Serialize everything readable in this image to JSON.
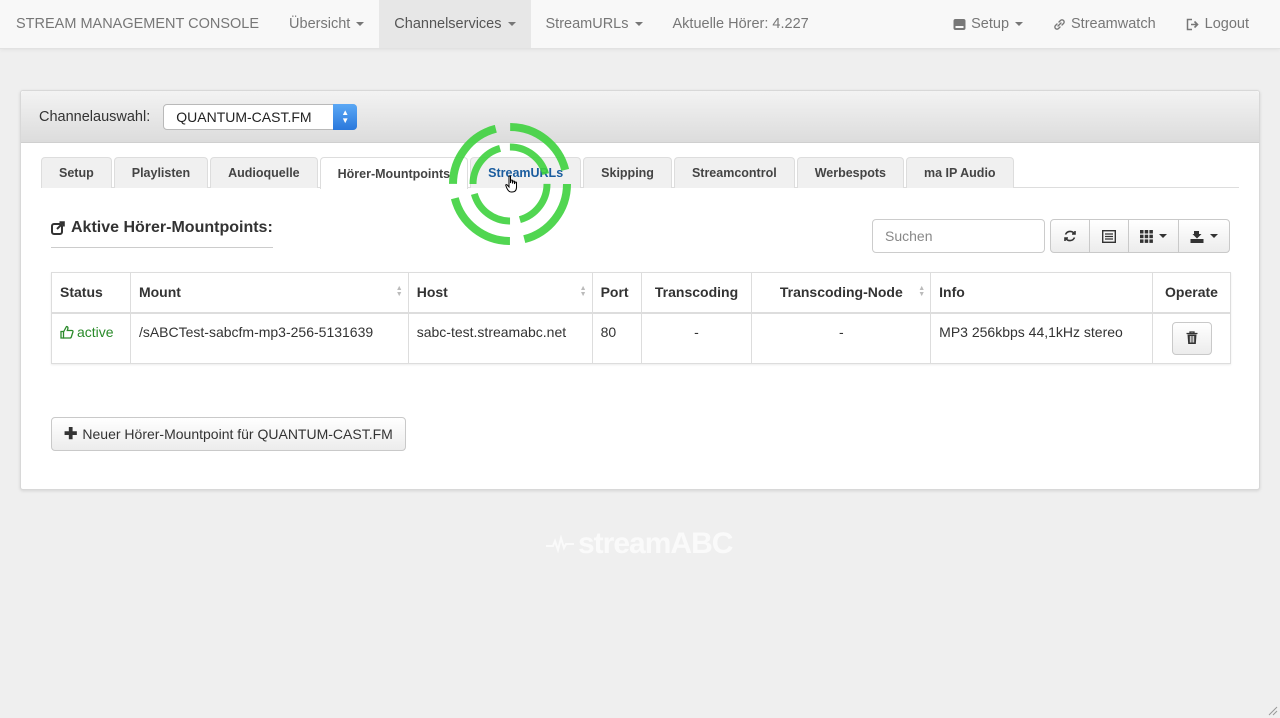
{
  "navbar": {
    "brand": "STREAM MANAGEMENT CONSOLE",
    "items": [
      {
        "label": "Übersicht",
        "dropdown": true
      },
      {
        "label": "Channelservices",
        "dropdown": true,
        "active": true
      },
      {
        "label": "StreamURLs",
        "dropdown": true
      },
      {
        "label": "Aktuelle Hörer: 4.227",
        "dropdown": false
      }
    ],
    "right": {
      "setup": "Setup",
      "streamwatch": "Streamwatch",
      "logout": "Logout"
    }
  },
  "panel": {
    "channel_label": "Channelauswahl:",
    "channel_value": "QUANTUM-CAST.FM",
    "tabs": [
      "Setup",
      "Playlisten",
      "Audioquelle",
      "Hörer-Mountpoints",
      "StreamURLs",
      "Skipping",
      "Streamcontrol",
      "Werbespots",
      "ma IP Audio"
    ],
    "active_tab": "Hörer-Mountpoints",
    "section_title": "Aktive Hörer-Mountpoints:",
    "search_placeholder": "Suchen",
    "table": {
      "columns": [
        "Status",
        "Mount",
        "Host",
        "Port",
        "Transcoding",
        "Transcoding-Node",
        "Info",
        "Operate"
      ],
      "rows": [
        {
          "status": "active",
          "mount": "/sABCTest-sabcfm-mp3-256-5131639",
          "host": "sabc-test.streamabc.net",
          "port": "80",
          "transcoding": "-",
          "transcoding_node": "-",
          "info": "MP3 256kbps 44,1kHz stereo"
        }
      ]
    },
    "new_button": "Neuer Hörer-Mountpoint für QUANTUM-CAST.FM"
  },
  "footer": {
    "logo_stream": "stream",
    "logo_abc": "ABC"
  },
  "colors": {
    "accent_select": "#2a78dc",
    "status_active": "#2a8a2a",
    "click_indicator": "#3ed23e"
  }
}
